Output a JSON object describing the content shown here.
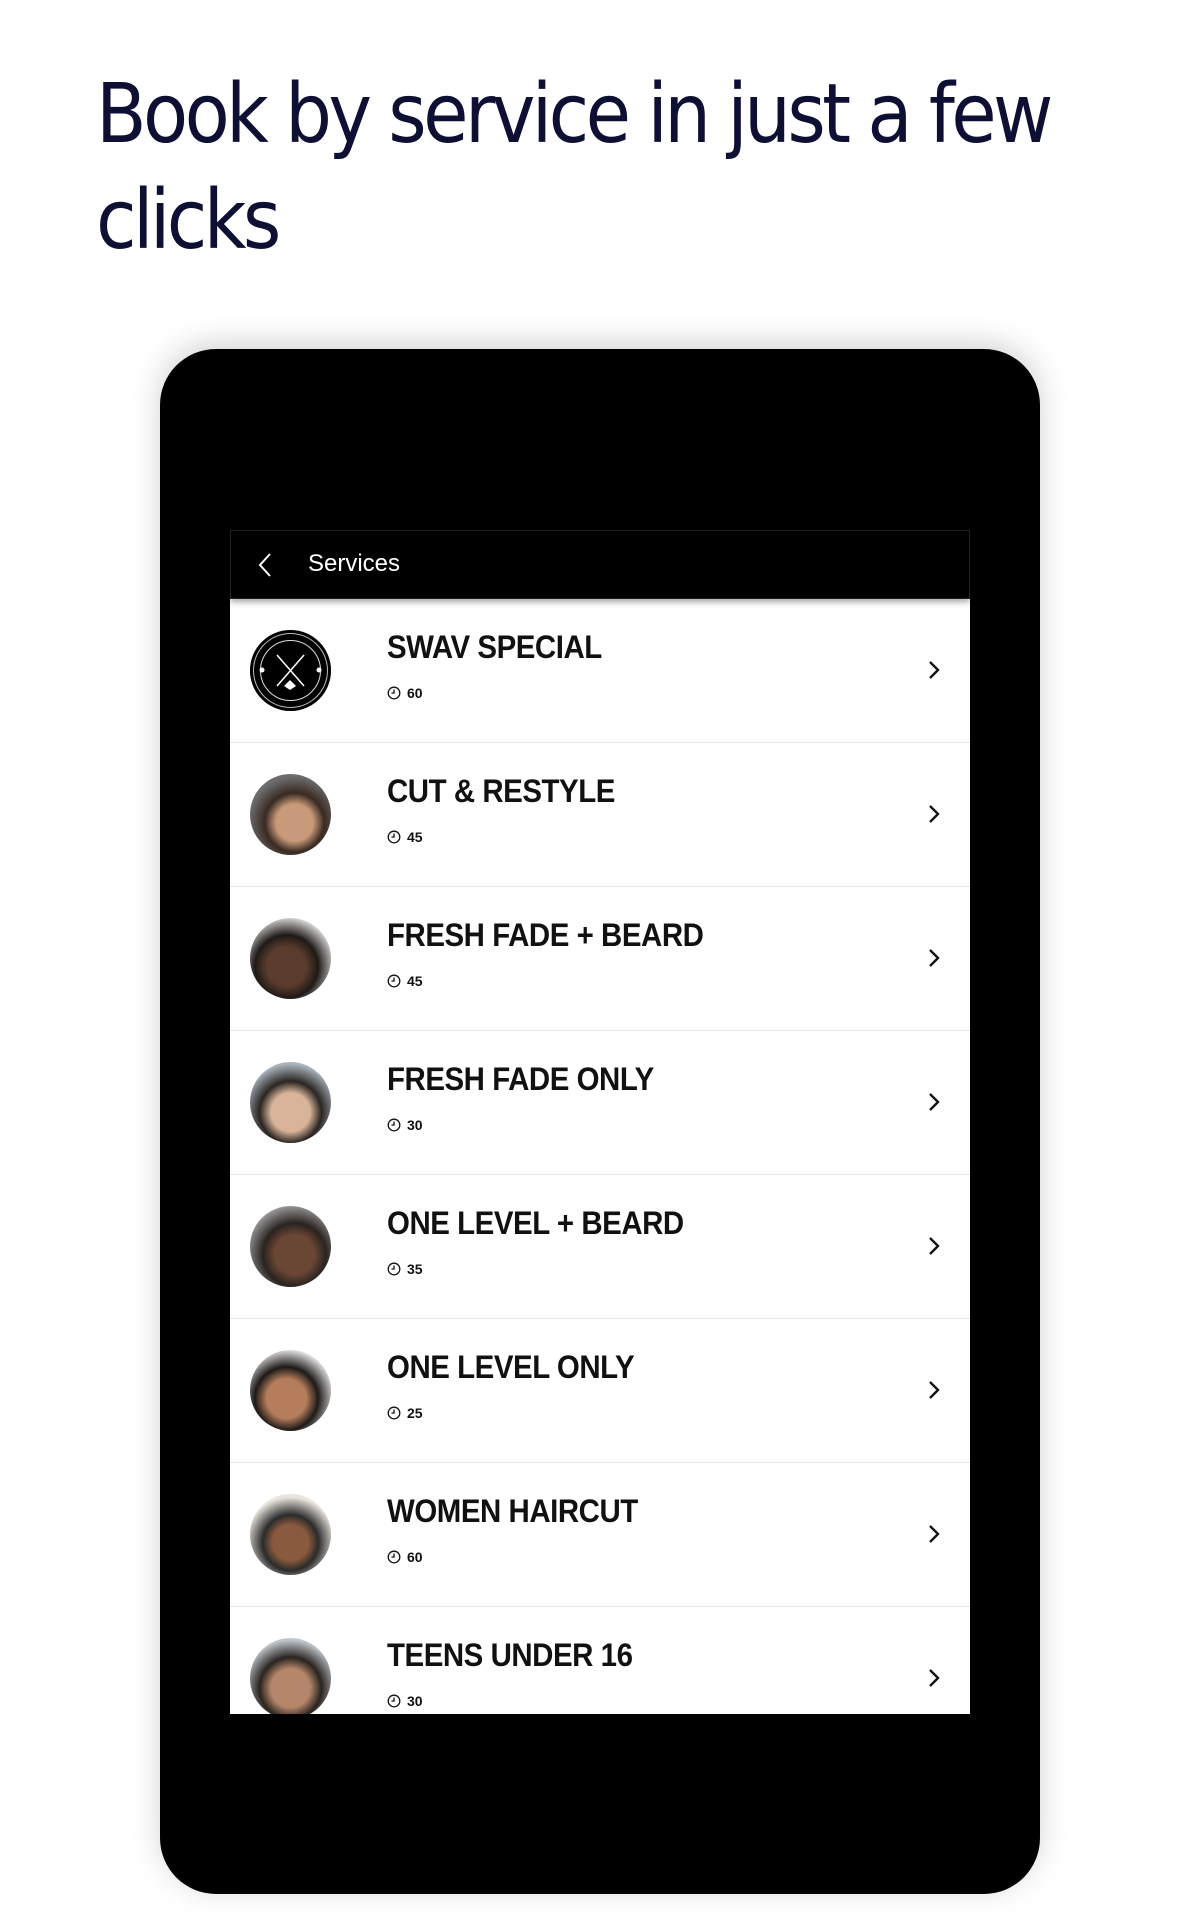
{
  "headline": "Book by service in just a few clicks",
  "app": {
    "title": "Services",
    "back_icon": "chevron-left-icon"
  },
  "services": [
    {
      "name": "SWAV SPECIAL",
      "duration": "60",
      "avatar": "logo"
    },
    {
      "name": "CUT & RESTYLE",
      "duration": "45",
      "avatar": "photo"
    },
    {
      "name": "FRESH FADE + BEARD",
      "duration": "45",
      "avatar": "photo"
    },
    {
      "name": "FRESH FADE ONLY",
      "duration": "30",
      "avatar": "photo"
    },
    {
      "name": "ONE LEVEL + BEARD",
      "duration": "35",
      "avatar": "photo"
    },
    {
      "name": "ONE LEVEL ONLY",
      "duration": "25",
      "avatar": "photo"
    },
    {
      "name": "WOMEN HAIRCUT",
      "duration": "60",
      "avatar": "photo"
    },
    {
      "name": "TEENS UNDER 16",
      "duration": "30",
      "avatar": "photo"
    }
  ],
  "colors": {
    "headline": "#0d0f33",
    "device": "#000000",
    "appbar": "#000000"
  }
}
